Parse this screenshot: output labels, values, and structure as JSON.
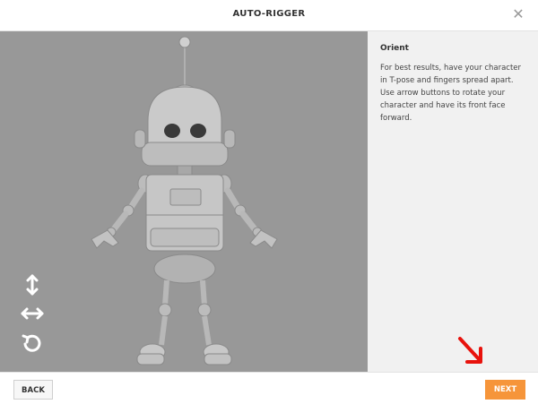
{
  "window": {
    "title": "AUTO-RIGGER",
    "close_icon": "close-icon"
  },
  "viewport": {
    "background": "#989898",
    "tools": [
      {
        "icon": "vertical-arrows-icon",
        "label": "rotate vertically"
      },
      {
        "icon": "horizontal-arrows-icon",
        "label": "rotate horizontally"
      },
      {
        "icon": "reset-rotation-icon",
        "label": "reset"
      }
    ]
  },
  "panel": {
    "heading": "Orient",
    "text": "For best results, have your character in T-pose and fingers spread apart. Use arrow buttons to rotate your character and have its front face forward."
  },
  "footer": {
    "back_label": "BACK",
    "next_label": "NEXT"
  },
  "colors": {
    "accent": "#f6953a",
    "annotation": "#e8120c"
  }
}
